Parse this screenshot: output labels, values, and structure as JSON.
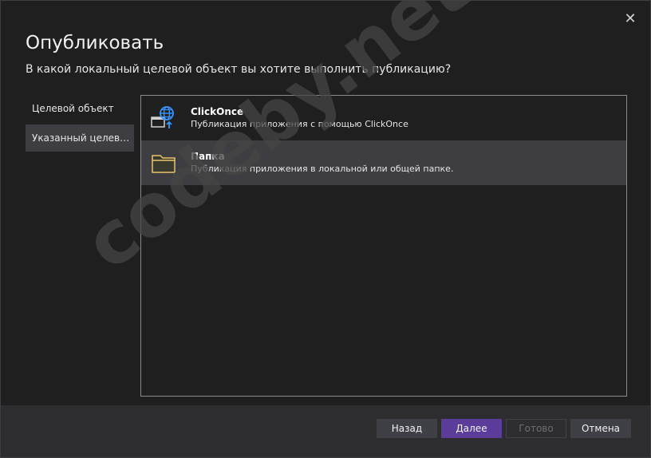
{
  "dialog": {
    "title": "Опубликовать",
    "subtitle": "В какой локальный целевой объект вы хотите выполнить публикацию?",
    "close_glyph": "✕"
  },
  "nav": {
    "items": [
      {
        "label": "Целевой объект"
      },
      {
        "label": "Указанный целевой..."
      }
    ]
  },
  "targets": [
    {
      "name": "ClickOnce",
      "description": "Публикация приложения с помощью ClickOnce",
      "icon": "clickonce-globe-icon"
    },
    {
      "name": "Папка",
      "description": "Публикация приложения в локальной или общей папке.",
      "icon": "folder-icon"
    }
  ],
  "footer": {
    "back_label": "Назад",
    "next_label": "Далее",
    "finish_label": "Готово",
    "cancel_label": "Отмена"
  },
  "watermark": "codeby.net",
  "colors": {
    "background": "#1f1f1f",
    "footer": "#2d2d30",
    "selected": "#3e3e42",
    "accent": "#5b3c9b"
  }
}
